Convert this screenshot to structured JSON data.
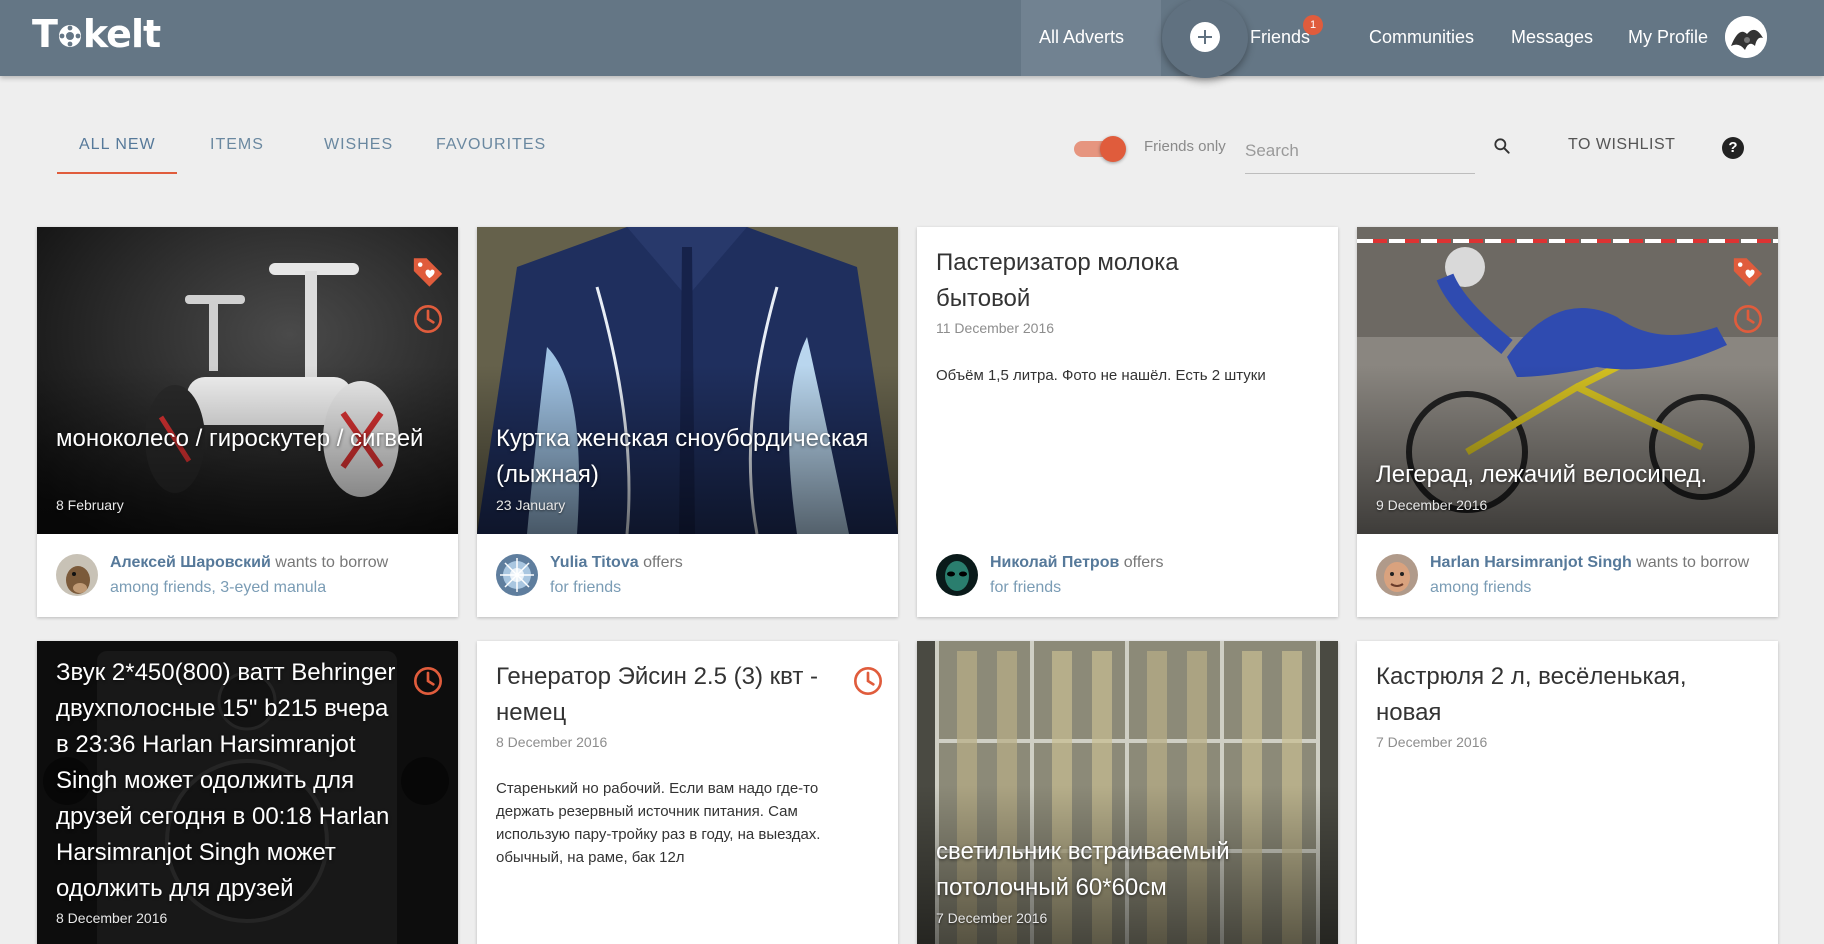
{
  "app": {
    "logo_text_pre": "T",
    "logo_text_post": "kelt"
  },
  "nav": {
    "adverts": "All Adverts",
    "friends": "Friends",
    "friends_badge": "1",
    "communities": "Communities",
    "messages": "Messages",
    "profile": "My Profile",
    "add_icon": "plus-circle-icon"
  },
  "filters": {
    "tabs": [
      {
        "label": "ALL NEW",
        "active": true
      },
      {
        "label": "ITEMS",
        "active": false
      },
      {
        "label": "WISHES",
        "active": false
      },
      {
        "label": "FAVOURITES",
        "active": false
      }
    ],
    "friends_only_label": "Friends only",
    "friends_only_on": true,
    "search_placeholder": "Search",
    "search_value": "",
    "wishlist_label": "TO WISHLIST",
    "help_label": "?"
  },
  "colors": {
    "topbar": "#647685",
    "accent": "#e05c3c",
    "link": "#56799a",
    "muted_link": "#7a9cb5"
  },
  "cards": [
    {
      "kind": "image",
      "title": "моноколесо / гироскутер / сигвей",
      "date": "8 February",
      "icons": [
        "tag-heart-icon",
        "clock-icon"
      ],
      "user": "Алексей Шаровский",
      "action": "wants to borrow",
      "audience": "among friends, 3-eyed manula"
    },
    {
      "kind": "image",
      "title": "Куртка женская сноубордическая (лыжная)",
      "date": "23 January",
      "icons": [],
      "user": "Yulia Titova",
      "action": "offers",
      "audience": "for friends"
    },
    {
      "kind": "text",
      "title": "Пастеризатор молока бытовой",
      "date": "11 December 2016",
      "description": "Объём 1,5 литра. Фото не нашёл. Есть 2 штуки",
      "icons": [],
      "user": "Николай Петров",
      "action": "offers",
      "audience": "for friends"
    },
    {
      "kind": "image",
      "title": "Легерад, лежачий велосипед.",
      "date": "9 December 2016",
      "icons": [
        "tag-heart-icon",
        "clock-icon"
      ],
      "user": "Harlan Harsimranjot Singh",
      "action": "wants to borrow",
      "audience": "among friends"
    },
    {
      "kind": "image",
      "title": "Звук 2*450(800) ватт Behringer двухполосные 15\" b215 вчера в 23:36 Harlan Harsimranjot Singh может одолжить для друзей сегодня в 00:18 Harlan Harsimranjot Singh может одолжить для друзей",
      "date": "8 December 2016",
      "icons": [
        "clock-icon"
      ]
    },
    {
      "kind": "text",
      "title": "Генератор Эйсин 2.5 (3) квт - немец",
      "date": "8 December 2016",
      "description": "Старенький но рабочий. Если вам надо где-то держать резервный источник питания. Сам использую пару-тройку раз в году, на выездах. обычный, на раме, бак 12л",
      "icons": [
        "clock-icon"
      ]
    },
    {
      "kind": "image",
      "title": "светильник встраиваемый потолочный 60*60см",
      "date": "7 December 2016",
      "icons": []
    },
    {
      "kind": "text",
      "title": "Кастрюля 2 л, весёленькая, новая",
      "date": "7 December 2016",
      "icons": []
    }
  ]
}
